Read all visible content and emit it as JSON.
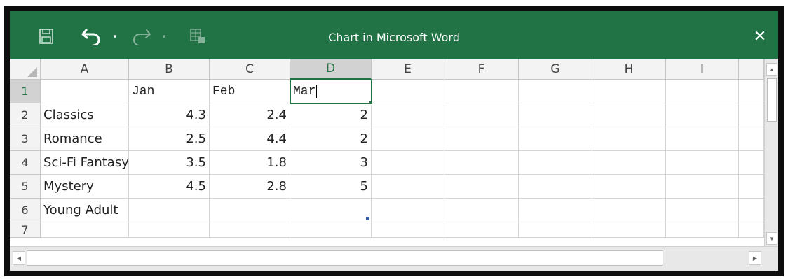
{
  "window": {
    "title": "Chart in Microsoft Word",
    "close_label": "✕",
    "undo_dropdown": "▾",
    "redo_dropdown": "▾"
  },
  "sheet": {
    "corner_label": "",
    "columns": [
      "A",
      "B",
      "C",
      "D",
      "E",
      "F",
      "G",
      "H",
      "I"
    ],
    "rows": [
      "1",
      "2",
      "3",
      "4",
      "5",
      "6",
      "7"
    ],
    "active_column": "D",
    "active_row": "1",
    "cells": {
      "B1": "Jan",
      "C1": "Feb",
      "D1": "Mar",
      "A2": "Classics",
      "B2": "4.3",
      "C2": "2.4",
      "D2": "2",
      "A3": "Romance",
      "B3": "2.5",
      "C3": "4.4",
      "D3": "2",
      "A4": "Sci-Fi Fantasy",
      "B4": "3.5",
      "C4": "1.8",
      "D4": "3",
      "A5": "Mystery",
      "B5": "4.5",
      "C5": "2.8",
      "D5": "5",
      "A6": "Young Adult"
    }
  },
  "scrollbars": {
    "up_arrow": "▲",
    "down_arrow": "▼",
    "left_arrow": "◀",
    "right_arrow": "▶"
  },
  "colors": {
    "accent": "#217346",
    "frame": "#0d0d0d",
    "range_marker": "#3b5ba9"
  }
}
